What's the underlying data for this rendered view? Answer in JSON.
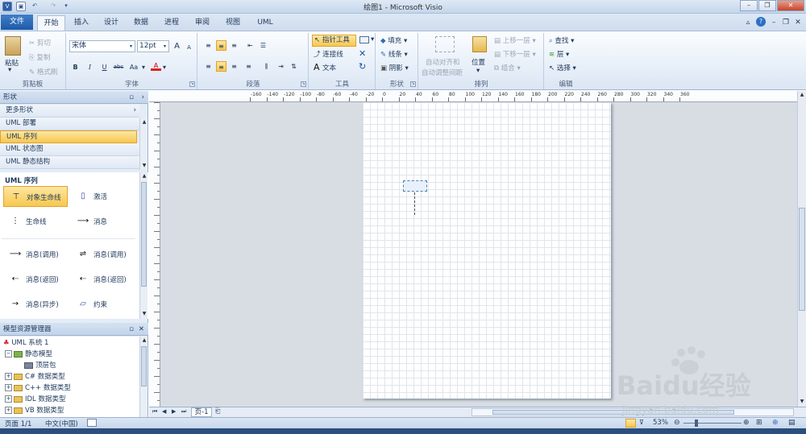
{
  "window": {
    "title": "绘图1  -  Microsoft Visio"
  },
  "tabs": [
    "开始",
    "插入",
    "设计",
    "数据",
    "进程",
    "审阅",
    "视图",
    "UML"
  ],
  "file_tab": "文件",
  "ribbon": {
    "clipboard": {
      "paste": "粘贴",
      "cut": "剪切",
      "copy": "复制",
      "format_painter": "格式刷",
      "label": "剪贴板"
    },
    "font": {
      "name": "宋体",
      "size": "12pt",
      "label": "字体",
      "bold": "B",
      "italic": "I",
      "underline": "U",
      "strike": "abc",
      "case": "Aa",
      "color": "A",
      "grow": "A",
      "shrink": "A"
    },
    "paragraph": {
      "label": "段落"
    },
    "tools": {
      "pointer": "指针工具",
      "connector": "连接线",
      "text": "文本",
      "label": "工具"
    },
    "shape": {
      "fill": "填充",
      "line": "线条",
      "shadow": "阴影",
      "label": "形状"
    },
    "arrange": {
      "align": "自动对齐和",
      "align2": "自动调整间距",
      "position": "位置",
      "bring_forward": "上移一层",
      "send_backward": "下移一层",
      "group": "组合",
      "label": "排列"
    },
    "editing": {
      "find": "查找",
      "layers": "层",
      "select": "选择",
      "label": "编辑"
    }
  },
  "shapes_panel": {
    "title": "形状",
    "more": "更多形状",
    "stencils": [
      "UML 部署",
      "UML 序列",
      "UML 状态图",
      "UML 静态结构"
    ],
    "active_stencil": "UML 序列",
    "items": [
      {
        "icon": "object-lifeline-icon",
        "label": "对象生命线"
      },
      {
        "icon": "activation-icon",
        "label": "激活"
      },
      {
        "icon": "lifeline-icon",
        "label": "生命线"
      },
      {
        "icon": "message-icon",
        "label": "消息"
      },
      {
        "icon": "message-call-icon",
        "label": "消息(调用)"
      },
      {
        "icon": "message-call2-icon",
        "label": "消息(调用)"
      },
      {
        "icon": "message-return-icon",
        "label": "消息(返回)"
      },
      {
        "icon": "message-return2-icon",
        "label": "消息(返回)"
      },
      {
        "icon": "message-async-icon",
        "label": "消息(异步)"
      },
      {
        "icon": "constraint-icon",
        "label": "约束"
      }
    ]
  },
  "model_explorer": {
    "title": "模型资源管理器",
    "nodes": [
      {
        "label": "UML 系统 1"
      },
      {
        "label": "静态模型"
      },
      {
        "label": "顶层包"
      },
      {
        "label": "C# 数据类型"
      },
      {
        "label": "C++ 数据类型"
      },
      {
        "label": "IDL 数据类型"
      },
      {
        "label": "VB 数据类型"
      }
    ]
  },
  "ruler_ticks": [
    "-160",
    "-140",
    "-120",
    "-100",
    "-80",
    "-60",
    "-40",
    "-20",
    "0",
    "20",
    "40",
    "60",
    "80",
    "100",
    "120",
    "140",
    "160",
    "180",
    "200",
    "220",
    "240",
    "260",
    "280",
    "300",
    "320",
    "340",
    "360"
  ],
  "page_tabs": {
    "page": "页-1"
  },
  "status": {
    "page": "页面 1/1",
    "lang": "中文(中国)",
    "zoom": "53%"
  },
  "watermark": {
    "text": "Baidu经验",
    "url": "jingyan.baidu.com"
  }
}
